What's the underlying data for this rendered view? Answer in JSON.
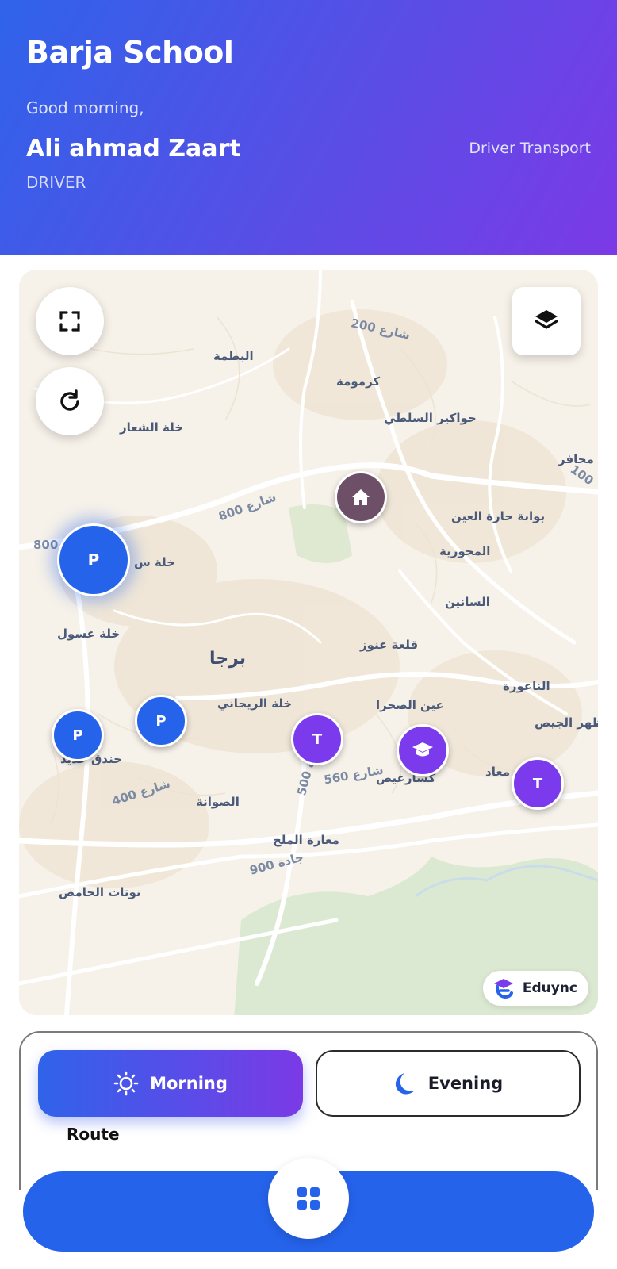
{
  "header": {
    "school_name": "Barja School",
    "greeting": "Good morning,",
    "user_name": "Ali ahmad Zaart",
    "role": "DRIVER",
    "subtitle": "Driver Transport"
  },
  "map": {
    "labels": [
      "البطمة",
      "كرمومة",
      "حواكير السلطي",
      "خلة الشعار",
      "بوابة حارة العين",
      "المحورية",
      "السانين",
      "خلة س",
      "خلة عسول",
      "برجا",
      "قلعة عنوز",
      "الناعورة",
      "خلة الريحاني",
      "عين الصحرا",
      "ظهر الجيص",
      "خندق حديد",
      "كسارغيص",
      "الصوانة",
      "معارة الملح",
      "نوتات الحامض",
      "محافر",
      "معاد"
    ],
    "road_labels": [
      "شارع 200",
      "شارع 800",
      "800",
      "100",
      "شارع 400",
      "شارع 560",
      "جادة 500",
      "جادة 900"
    ],
    "markers": [
      {
        "type": "pickup",
        "label": "P"
      },
      {
        "type": "pickup",
        "label": "P"
      },
      {
        "type": "pickup",
        "label": "P"
      },
      {
        "type": "teacher",
        "label": "T"
      },
      {
        "type": "teacher",
        "label": "T"
      },
      {
        "type": "school",
        "icon": "graduation-cap-icon"
      },
      {
        "type": "home",
        "icon": "home-icon"
      }
    ],
    "brand": "Eduync",
    "colors": {
      "pickup": "#2563eb",
      "teacher": "#7c3aed",
      "home": "#6d4f68"
    }
  },
  "tabs": {
    "morning": "Morning",
    "evening": "Evening",
    "route_label": "Route"
  },
  "colors": {
    "accent": "#2563eb",
    "gradient_end": "#7b3ae6"
  }
}
